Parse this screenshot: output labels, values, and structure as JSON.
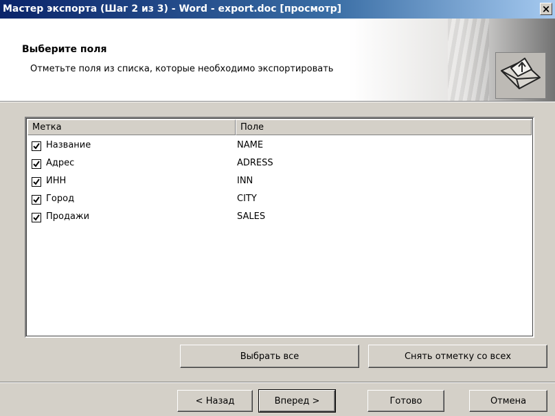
{
  "window": {
    "title": "Мастер экспорта (Шаг 2 из 3) - Word - export.doc [просмотр]",
    "close_glyph": "×"
  },
  "header": {
    "title": "Выберите поля",
    "subtitle": "Отметьте поля из списка, которые необходимо экспортировать",
    "icon": "envelope-arrow-icon"
  },
  "list": {
    "columns": [
      "Метка",
      "Поле"
    ],
    "rows": [
      {
        "label": "Название",
        "field": "NAME",
        "checked": true
      },
      {
        "label": "Адрес",
        "field": "ADRESS",
        "checked": true
      },
      {
        "label": "ИНН",
        "field": "INN",
        "checked": true
      },
      {
        "label": "Город",
        "field": "CITY",
        "checked": true
      },
      {
        "label": "Продажи",
        "field": "SALES",
        "checked": true
      }
    ]
  },
  "selection_buttons": {
    "select_all": "Выбрать все",
    "clear_all": "Снять отметку со всех"
  },
  "nav_buttons": {
    "back": "< Назад",
    "next": "Вперед >",
    "finish": "Готово",
    "cancel": "Отмена"
  },
  "colors": {
    "titlebar_start": "#0a246a",
    "titlebar_end": "#a6caf0",
    "dialog_face": "#d4d0c8"
  }
}
